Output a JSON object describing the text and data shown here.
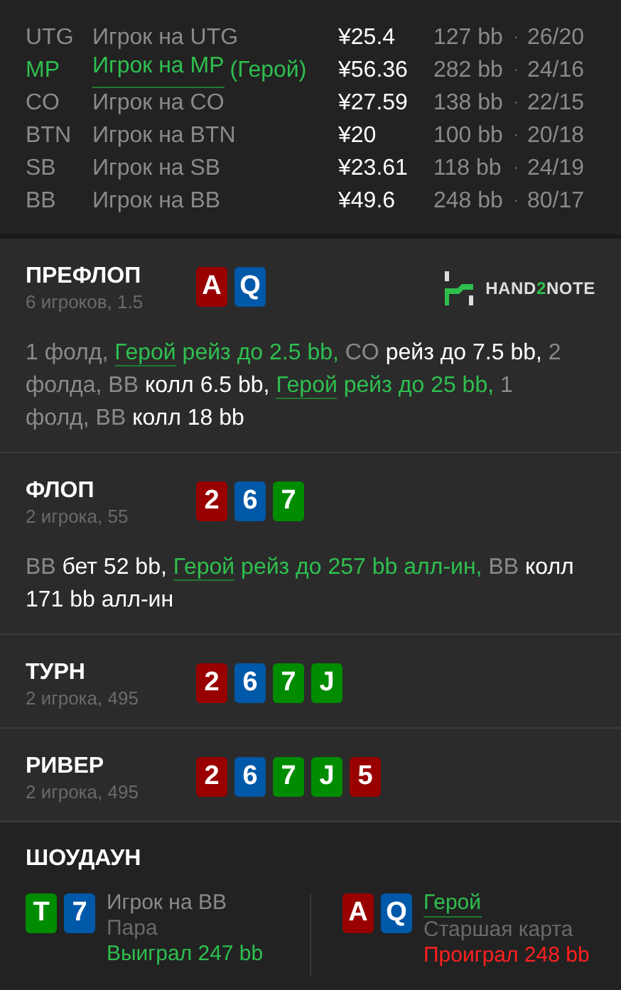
{
  "players": [
    {
      "position": "UTG",
      "name": "Игрок на UTG",
      "hero": false,
      "stack": "¥25.4",
      "bb": "127 bb",
      "separator": "·",
      "record": "26/20"
    },
    {
      "position": "MP",
      "name": "Игрок на MP",
      "hero": true,
      "hero_tag": "(Герой)",
      "stack": "¥56.36",
      "bb": "282 bb",
      "separator": "·",
      "record": "24/16"
    },
    {
      "position": "CO",
      "name": "Игрок на CO",
      "hero": false,
      "stack": "¥27.59",
      "bb": "138 bb",
      "separator": "·",
      "record": "22/15"
    },
    {
      "position": "BTN",
      "name": "Игрок на BTN",
      "hero": false,
      "stack": "¥20",
      "bb": "100 bb",
      "separator": "·",
      "record": "20/18"
    },
    {
      "position": "SB",
      "name": "Игрок на SB",
      "hero": false,
      "stack": "¥23.61",
      "bb": "118 bb",
      "separator": "·",
      "record": "24/19"
    },
    {
      "position": "BB",
      "name": "Игрок на BB",
      "hero": false,
      "stack": "¥49.6",
      "bb": "248 bb",
      "separator": "·",
      "record": "80/17"
    }
  ],
  "logo": {
    "parts": [
      "HAND",
      "2",
      "NOTE"
    ]
  },
  "streets": [
    {
      "title": "ПРЕФЛОП",
      "subtitle": "6 игроков, 1.5",
      "cards": [
        {
          "rank": "A",
          "color": "#990000"
        },
        {
          "rank": "Q",
          "color": "#0058a8"
        }
      ],
      "actions": [
        {
          "kind": "muted",
          "text": "1 фолд, "
        },
        {
          "kind": "hero",
          "text": "Герой"
        },
        {
          "kind": "hero_action",
          "text": " рейз до 2.5 bb, "
        },
        {
          "kind": "muted",
          "text": "CO "
        },
        {
          "kind": "action",
          "text": "рейз до 7.5 bb, "
        },
        {
          "kind": "muted",
          "text": "2 фолда, BB "
        },
        {
          "kind": "action",
          "text": "колл 6.5 bb, "
        },
        {
          "kind": "hero",
          "text": "Герой"
        },
        {
          "kind": "hero_action",
          "text": " рейз до 25 bb, "
        },
        {
          "kind": "muted",
          "text": "1 фолд, BB "
        },
        {
          "kind": "action",
          "text": "колл 18 bb"
        }
      ]
    },
    {
      "title": "ФЛОП",
      "subtitle": "2 игрока, 55",
      "cards": [
        {
          "rank": "2",
          "color": "#990000"
        },
        {
          "rank": "6",
          "color": "#0058a8"
        },
        {
          "rank": "7",
          "color": "#008c00"
        }
      ],
      "actions": [
        {
          "kind": "muted",
          "text": "BB "
        },
        {
          "kind": "action",
          "text": "бет 52 bb, "
        },
        {
          "kind": "hero",
          "text": "Герой"
        },
        {
          "kind": "hero_action",
          "text": " рейз до 257 bb алл-ин, "
        },
        {
          "kind": "muted",
          "text": "BB "
        },
        {
          "kind": "action",
          "text": "колл 171 bb алл-ин"
        }
      ]
    },
    {
      "title": "ТУРН",
      "subtitle": "2 игрока, 495",
      "cards": [
        {
          "rank": "2",
          "color": "#990000"
        },
        {
          "rank": "6",
          "color": "#0058a8"
        },
        {
          "rank": "7",
          "color": "#008c00"
        },
        {
          "rank": "J",
          "color": "#008c00"
        }
      ]
    },
    {
      "title": "РИВЕР",
      "subtitle": "2 игрока, 495",
      "cards": [
        {
          "rank": "2",
          "color": "#990000"
        },
        {
          "rank": "6",
          "color": "#0058a8"
        },
        {
          "rank": "7",
          "color": "#008c00"
        },
        {
          "rank": "J",
          "color": "#008c00"
        },
        {
          "rank": "5",
          "color": "#990000"
        }
      ]
    }
  ],
  "showdown": {
    "title": "ШОУДАУН",
    "hands": [
      {
        "cards": [
          {
            "rank": "T",
            "color": "#008c00"
          },
          {
            "rank": "7",
            "color": "#0058a8"
          }
        ],
        "name": "Игрок на BB",
        "hero": false,
        "hand": "Пара",
        "result": "Выиграл 247 bb",
        "won": true
      },
      {
        "cards": [
          {
            "rank": "A",
            "color": "#990000"
          },
          {
            "rank": "Q",
            "color": "#0058a8"
          }
        ],
        "name": "Герой",
        "hero": true,
        "hand": "Старшая карта",
        "result": "Проиграл 248 bb",
        "won": false
      }
    ]
  }
}
